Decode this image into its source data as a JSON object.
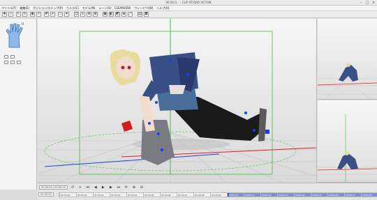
{
  "window": {
    "title": "00:00:0… - CLIP STUDIO ACTION"
  },
  "menu": [
    "ファイル(F)",
    "編集(E)",
    "ポジション/ステップ(P)",
    "カメラ(C)",
    "モデル(M)",
    "シーン(S)",
    "CLEARVIEW",
    "ウィンドウ(W)",
    "ヘルプ(H)"
  ],
  "timeline": {
    "start_field": "00:00:00 / 00:00:10",
    "frame_field": "00:00:00",
    "ticks": [
      "00:00:00",
      "00:00:01",
      "00:00:02",
      "00:00:03",
      "00:00:04",
      "00:00:05",
      "00:00:06",
      "00:00:07",
      "00:00:08",
      "00:00:09",
      "00:00:10",
      "00:00:11",
      "00:00:12",
      "00:00:13",
      "00:00:14",
      "00:00:15",
      "00:00:16",
      "00:00:17",
      "00:00:18"
    ]
  },
  "colors": {
    "bound_box": "#3fbf3f",
    "axis_x": "#e02020",
    "axis_z": "#2040d0",
    "joint": "#1a3cff"
  }
}
